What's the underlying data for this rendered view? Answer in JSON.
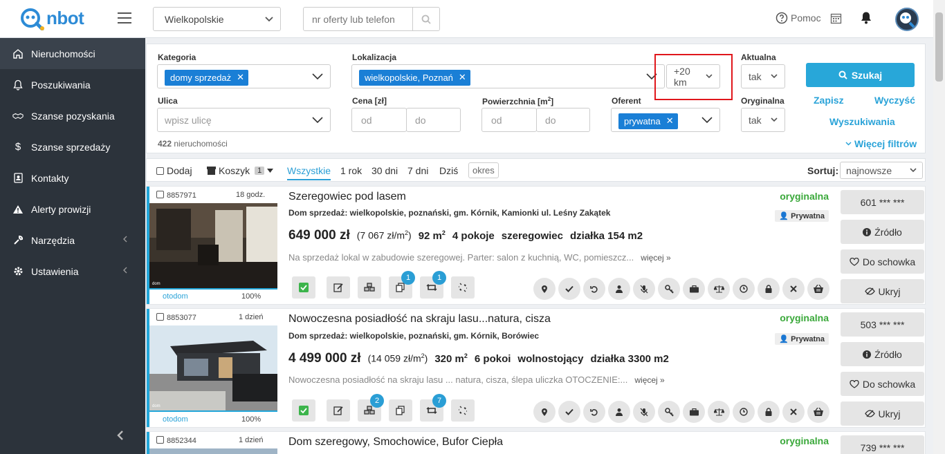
{
  "app": {
    "logo_text": "nbot"
  },
  "header": {
    "region_value": "Wielkopolskie",
    "search_placeholder": "nr oferty lub telefon",
    "help_label": "Pomoc"
  },
  "sidebar": {
    "items": [
      {
        "label": "Nieruchomości",
        "icon": "home-icon"
      },
      {
        "label": "Poszukiwania",
        "icon": "bell-icon"
      },
      {
        "label": "Szanse pozyskania",
        "icon": "handshake-icon"
      },
      {
        "label": "Szanse sprzedaży",
        "icon": "dollar-icon"
      },
      {
        "label": "Kontakty",
        "icon": "contact-icon"
      },
      {
        "label": "Alerty prowizji",
        "icon": "warning-icon"
      },
      {
        "label": "Narzędzia",
        "icon": "wrench-icon"
      },
      {
        "label": "Ustawienia",
        "icon": "gear-icon"
      }
    ]
  },
  "filters": {
    "kategoria_label": "Kategoria",
    "kategoria_tag": "domy sprzedaż",
    "lokalizacja_label": "Lokalizacja",
    "lokalizacja_tag": "wielkopolskie, Poznań",
    "radius_value": "+20 km",
    "aktualna_label": "Aktualna",
    "aktualna_value": "tak",
    "ulica_label": "Ulica",
    "ulica_placeholder": "wpisz ulicę",
    "cena_label": "Cena [zł]",
    "powierzchnia_label": "Powierzchnia [m",
    "powierzchnia_sup": "2",
    "powierzchnia_close": "]",
    "od": "od",
    "do": "do",
    "oferent_label": "Oferent",
    "oferent_tag": "prywatna",
    "oryginalna_label": "Oryginalna",
    "oryginalna_value": "tak",
    "search_button": "Szukaj",
    "save_link": "Zapisz",
    "clear_link": "Wyczyść",
    "searches_link": "Wyszukiwania",
    "more_filters": "Więcej filtrów",
    "count_num": "422",
    "count_text": "nieruchomości"
  },
  "toolbar": {
    "dodaj": "Dodaj",
    "koszyk": "Koszyk",
    "koszyk_count": "1",
    "periods": [
      "Wszystkie",
      "1 rok",
      "30 dni",
      "7 dni",
      "Dziś"
    ],
    "okres": "okres",
    "sort_label": "Sortuj:",
    "sort_value": "najnowsze"
  },
  "listings": [
    {
      "id": "8857971",
      "age": "18 godz.",
      "source": "otodom",
      "percent": "100%",
      "title": "Szeregowiec pod lasem",
      "address": "Dom sprzedaż: wielkopolskie, poznański, gm. Kórnik, Kamionki ul. Leśny Zakątek",
      "price": "649 000 zł",
      "price_m2_a": "(7 067 zł/m",
      "price_m2_sup": "2",
      "price_m2_b": ")",
      "area": "92 m",
      "area_sup": "2",
      "rooms": "4 pokoje",
      "type": "szeregowiec",
      "plot": "działka 154 m2",
      "description": "Na sprzedaż lokal w zabudowie szeregowej. Parter: salon z kuchnią, WC, pomieszcz...",
      "more": "więcej »",
      "status": "oryginalna",
      "offerer": "Prywatna",
      "phone": "601 *** ***",
      "badge_a": "1",
      "badge_b": "1",
      "badge_c": ""
    },
    {
      "id": "8853077",
      "age": "1 dzień",
      "source": "otodom",
      "percent": "100%",
      "title": "Nowoczesna posiadłość na skraju lasu...natura, cisza",
      "address": "Dom sprzedaż: wielkopolskie, poznański, gm. Kórnik, Borówiec",
      "price": "4 499 000 zł",
      "price_m2_a": "(14 059 zł/m",
      "price_m2_sup": "2",
      "price_m2_b": ")",
      "area": "320 m",
      "area_sup": "2",
      "rooms": "6 pokoi",
      "type": "wolnostojący",
      "plot": "działka 3300 m2",
      "description": "Nowoczesna posiadłość na skraju lasu ... natura, cisza, ślepa uliczka  OTOCZENIE:...",
      "more": "więcej »",
      "status": "oryginalna",
      "offerer": "Prywatna",
      "phone": "503 *** ***",
      "badge_a": "",
      "badge_b": "7",
      "badge_c": "2"
    },
    {
      "id": "8852344",
      "age": "1 dzień",
      "title": "Dom szeregowy, Smochowice, Bufor Ciepła",
      "status": "oryginalna",
      "phone": "739 *** ***"
    }
  ],
  "right_buttons": {
    "zrodlo": "Źródło",
    "schowek": "Do schowka",
    "ukryj": "Ukryj"
  },
  "colors": {
    "accent": "#21a6d9",
    "sidebar": "#2c333b",
    "tag": "#1a7fd6",
    "original": "#3aa83a",
    "highlight": "#e0161b"
  }
}
